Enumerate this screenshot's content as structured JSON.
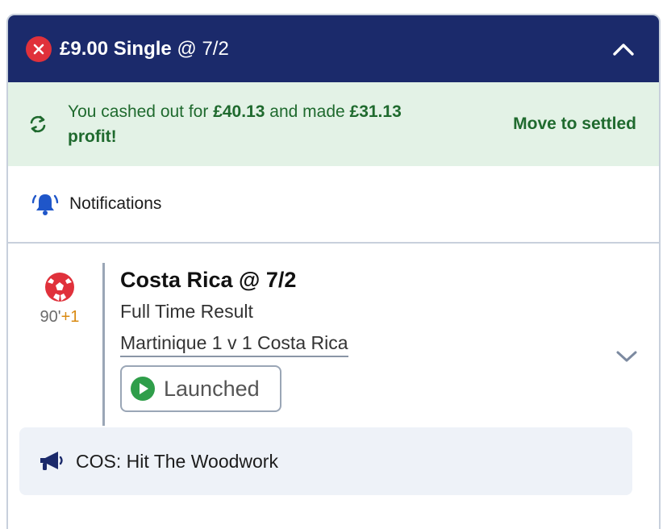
{
  "header": {
    "stake": "£9.00",
    "bet_type": "Single",
    "odds": "@ 7/2"
  },
  "cashout": {
    "prefix": "You cashed out for ",
    "amount": "£40.13",
    "middle": " and made ",
    "profit": "£31.13",
    "suffix": "profit!",
    "action": "Move to settled"
  },
  "notifications": {
    "label": "Notifications"
  },
  "selection": {
    "time": "90'",
    "added_time": "+1",
    "pick": "Costa Rica @ 7/2",
    "market": "Full Time Result",
    "event": "Martinique 1 v 1 Costa Rica",
    "status": "Launched"
  },
  "promo": {
    "text": "COS: Hit The Woodwork"
  },
  "colors": {
    "header_bg": "#1b2a6b",
    "cashout_bg": "#e3f2e6",
    "cashout_text": "#1f6a2e",
    "close_red": "#e0313b",
    "bell_blue": "#1f56c9",
    "play_green": "#2f9e4a",
    "promo_bg": "#eef2f8"
  },
  "icons": {
    "header_left": "close-icon",
    "header_right": "chevron-up-icon",
    "cashout": "refresh-icon",
    "notifications": "bell-icon",
    "sport": "football-icon",
    "status": "play-icon",
    "expand": "chevron-down-icon",
    "promo": "megaphone-icon"
  }
}
